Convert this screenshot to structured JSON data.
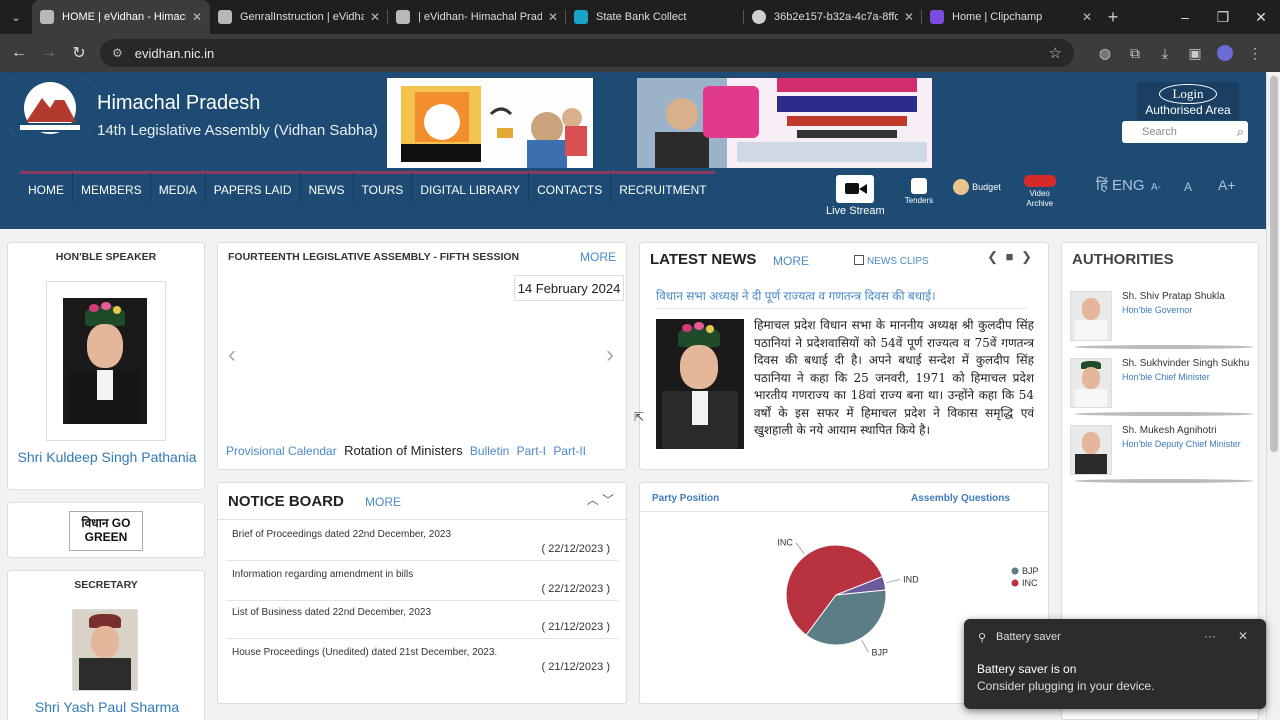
{
  "browser": {
    "tabs": [
      {
        "title": "HOME | eVidhan - Himachal",
        "active": true,
        "favicon_color": "#b8b8b8"
      },
      {
        "title": "GenralInstruction | eVidhan",
        "active": false,
        "favicon_color": "#b8b8b8"
      },
      {
        "title": "| eVidhan- Himachal Prade",
        "active": false,
        "favicon_color": "#b8b8b8"
      },
      {
        "title": "State Bank Collect",
        "active": false,
        "favicon_color": "#1aa3c9"
      },
      {
        "title": "36b2e157-b32a-4c7a-8ffc",
        "active": false,
        "favicon_color": "#cfcfcf"
      },
      {
        "title": "Home | Clipchamp",
        "active": false,
        "favicon_color": "#7d4be0"
      }
    ],
    "url": "evidhan.nic.in"
  },
  "site": {
    "state_name": "Himachal Pradesh",
    "assembly_name": "14th Legislative Assembly (Vidhan Sabha)",
    "login_label": "Login",
    "authorised_label": "Authorised Area",
    "search_placeholder": "Search",
    "nav": [
      "HOME",
      "MEMBERS",
      "MEDIA",
      "PAPERS LAID",
      "NEWS",
      "TOURS",
      "DIGITAL LIBRARY",
      "CONTACTS",
      "RECRUITMENT"
    ],
    "tools": {
      "live_stream": "Live Stream",
      "tenders": "Tenders",
      "budget": "Budget",
      "video_archive": "Video Archive"
    },
    "lang_toggle": "हिं ENG",
    "font_sizes": [
      "A-",
      "A",
      "A+"
    ]
  },
  "speaker": {
    "heading": "HON'BLE SPEAKER",
    "name": "Shri Kuldeep Singh Pathania"
  },
  "green": {
    "label": "विधान GO GREEN"
  },
  "secretary": {
    "heading": "SECRETARY",
    "name": "Shri Yash Paul Sharma"
  },
  "session": {
    "title": "FOURTEENTH LEGISLATIVE ASSEMBLY - FIFTH SESSION",
    "more": "MORE",
    "date": "14 February 2024",
    "links": [
      "Provisional Calendar",
      "Rotation of Ministers",
      "Bulletin",
      "Part-I",
      "Part-II"
    ]
  },
  "notice": {
    "title": "NOTICE BOARD",
    "more": "MORE",
    "items": [
      {
        "text": "Brief of Proceedings dated 22nd December, 2023",
        "date": "( 22/12/2023 )"
      },
      {
        "text": "Information regarding amendment in bills",
        "date": "( 22/12/2023 )"
      },
      {
        "text": "List of Business dated 22nd December, 2023",
        "date": "( 21/12/2023 )"
      },
      {
        "text": "House Proceedings (Unedited) dated 21st December, 2023.",
        "date": "( 21/12/2023 )"
      }
    ]
  },
  "news": {
    "title": "LATEST NEWS",
    "more": "MORE",
    "clips": "NEWS CLIPS",
    "headline": "विधान सभा अध्यक्ष ने दी पूर्ण राज्यत्व व गणतन्त्र दिवस की बधाई।",
    "body": "हिमाचल प्रदेश विधान सभा के माननीय अध्यक्ष श्री कुलदीप सिंह पठानियां ने प्रदेशवासियों को 54वें पूर्ण राज्यत्व व 75वें गणतन्त्र दिवस की बधाई दी है। अपने बधाई सन्देश में कुलदीप सिंह पठानिया ने कहा कि 25 जनवरी, 1971 को हिमाचल प्रदेश भारतीय गणराज्य का 18वां राज्य बना था। उन्होंने कहा कि 54 वर्षों के इस सफर में हिमाचल प्रदेश ने विकास समृद्धि एवं खुशहाली के नये आयाम स्थापित किये है।"
  },
  "party": {
    "party_position": "Party Position",
    "assembly_questions": "Assembly Questions"
  },
  "chart_data": {
    "type": "pie",
    "slices": [
      {
        "label": "INC",
        "value": 40,
        "color": "#b8333f"
      },
      {
        "label": "BJP",
        "value": 25,
        "color": "#5b7d86"
      },
      {
        "label": "IND",
        "value": 3,
        "color": "#6d5a9b"
      }
    ],
    "legend": [
      "BJP",
      "INC"
    ],
    "legend_position": "right"
  },
  "authorities": {
    "title": "AUTHORITIES",
    "items": [
      {
        "name": "Sh. Shiv Pratap Shukla",
        "role": "Hon'ble Governor"
      },
      {
        "name": "Sh. Sukhvinder Singh Sukhu",
        "role": "Hon'ble Chief Minister"
      },
      {
        "name": "Sh. Mukesh Agnihotri",
        "role": "Hon'ble Deputy Chief Minister"
      }
    ]
  },
  "toast": {
    "app": "Battery saver",
    "title": "Battery saver is on",
    "message": "Consider plugging in your device."
  }
}
